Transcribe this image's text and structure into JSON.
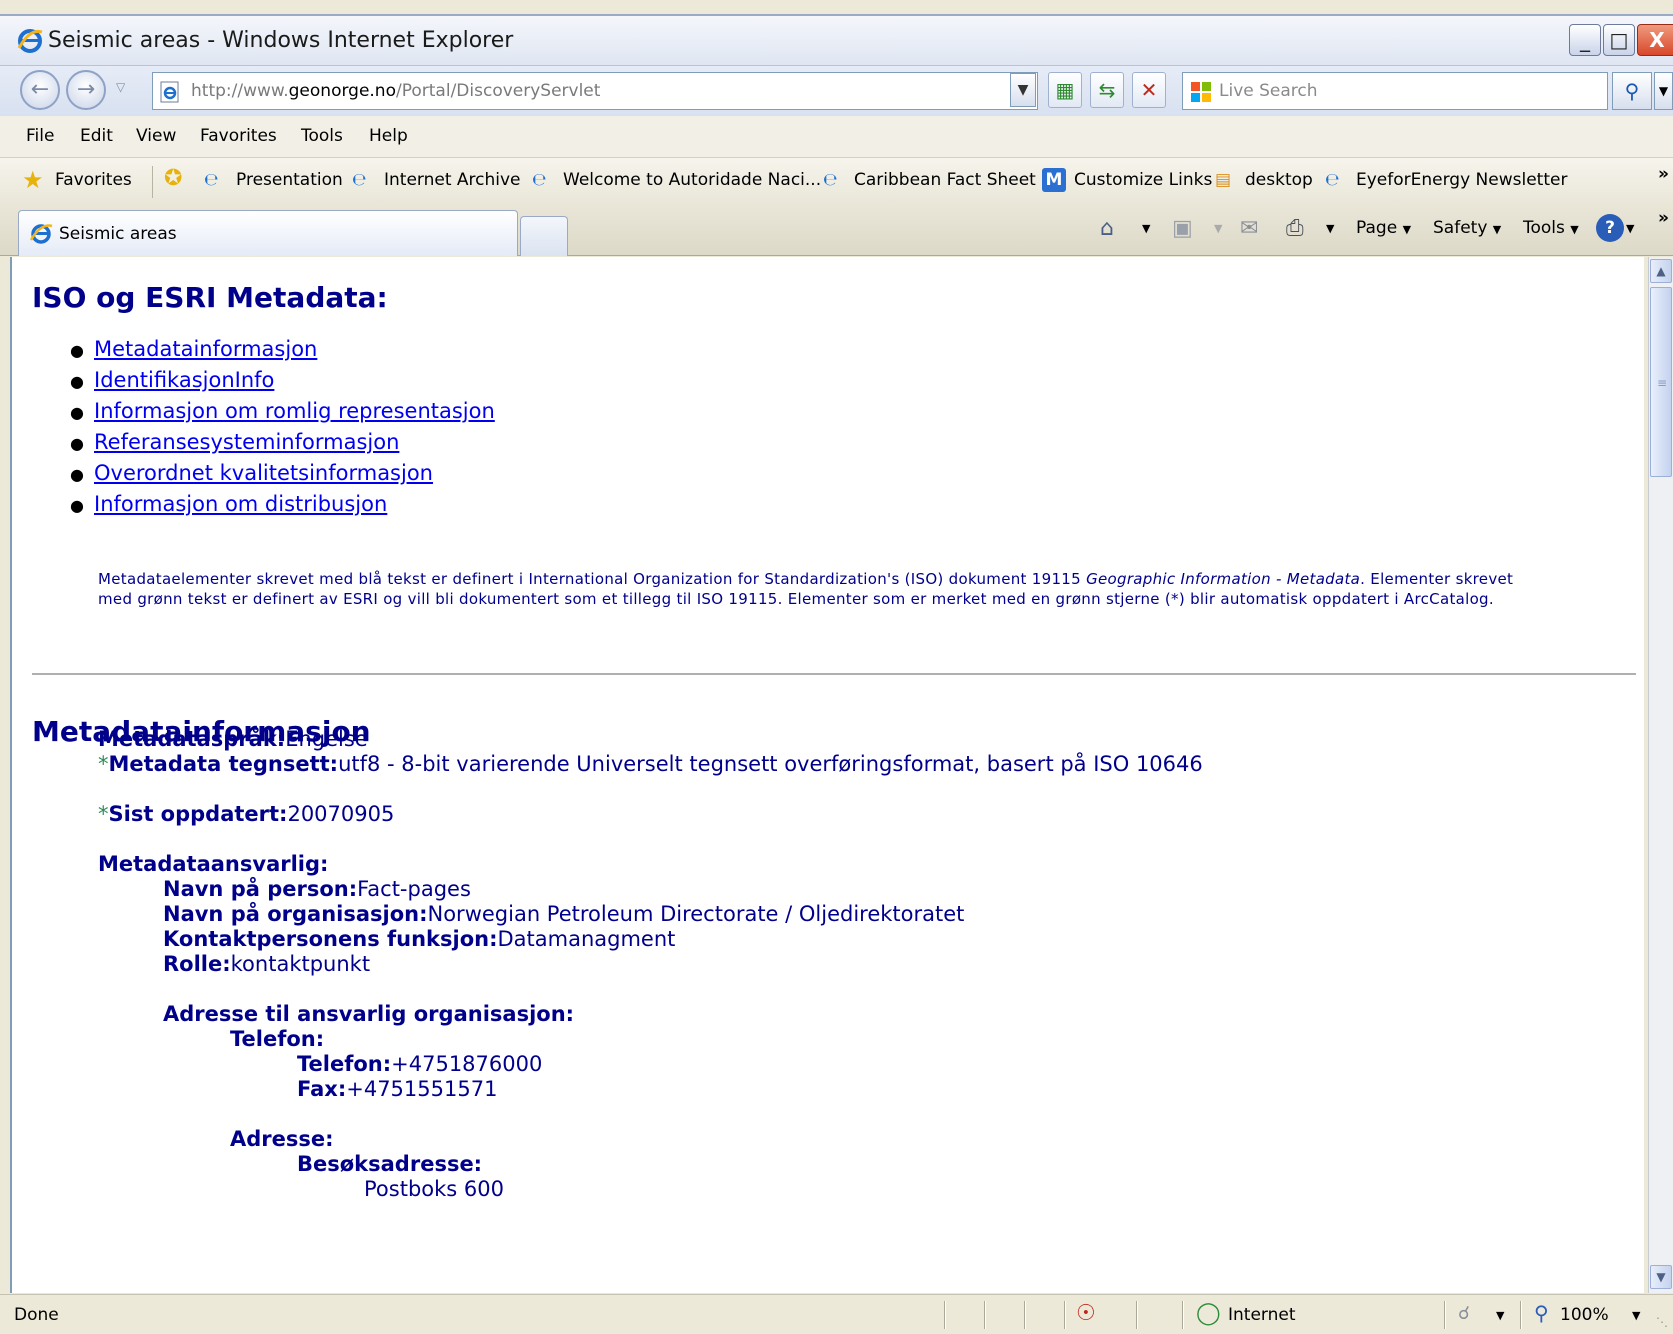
{
  "window": {
    "title": "Seismic areas - Windows Internet Explorer",
    "min_label": "_",
    "max_label": "□",
    "close_label": "X"
  },
  "address": {
    "url_prefix": "http://www.",
    "url_domain": "geonorge.no",
    "url_path": "/Portal/DiscoveryServlet",
    "search_placeholder": "Live Search"
  },
  "menu": {
    "items": [
      "File",
      "Edit",
      "View",
      "Favorites",
      "Tools",
      "Help"
    ]
  },
  "favorites_bar": {
    "favorites_label": "Favorites",
    "links": [
      "Presentation",
      "Internet Archive",
      "Welcome to Autoridade Naci...",
      "Caribbean Fact Sheet",
      "Customize Links",
      "desktop",
      "EyeforEnergy Newsletter"
    ],
    "more": "»"
  },
  "tabs": {
    "active_title": "Seismic areas"
  },
  "command_bar": {
    "page": "Page",
    "safety": "Safety",
    "tools": "Tools",
    "more": "»"
  },
  "content": {
    "iso_heading": "ISO og ESRI Metadata:",
    "toc": [
      "Metadatainformasjon",
      "IdentifikasjonInfo",
      "Informasjon om romlig representasjon",
      "Referansesysteminformasjon",
      "Overordnet kvalitetsinformasjon",
      "Informasjon om distribusjon"
    ],
    "note_part1": "Metadataelementer skrevet med blå tekst er definert i International Organization for Standardization's (ISO) dokument 19115 ",
    "note_italic": "Geographic Information - Metadata",
    "note_part2": ". Elementer skrevet med grønn tekst er definert av ESRI og vill bli dokumentert som et tillegg til ISO 19115. Elementer som er merket med en grønn stjerne (*) blir automatisk oppdatert i ArcCatalog.",
    "meta_heading": "Metadatainformasjon",
    "star": "*",
    "language_label": "Metadataspråk:",
    "language_value": "Engelse",
    "charset_label": "Metadata tegnsett:",
    "charset_value": "utf8 - 8-bit varierende Universelt tegnsett overføringsformat, basert på ISO 10646",
    "updated_label": "Sist oppdatert:",
    "updated_value": "20070905",
    "responsible_label": "Metadataansvarlig:",
    "person_label": "Navn på person:",
    "person_value": "Fact-pages",
    "org_label": "Navn på organisasjon:",
    "org_value": "Norwegian Petroleum Directorate / Oljedirektoratet",
    "function_label": "Kontaktpersonens funksjon:",
    "function_value": "Datamanagment",
    "role_label": "Rolle:",
    "role_value": "kontaktpunkt",
    "address_org_label": "Adresse til ansvarlig organisasjon:",
    "phone_group_label": "Telefon:",
    "phone_label": "Telefon:",
    "phone_value": "+4751876000",
    "fax_label": "Fax:",
    "fax_value": "+4751551571",
    "address_label": "Adresse:",
    "visit_label": "Besøksadresse:",
    "visit_value": "Postboks 600"
  },
  "status": {
    "text": "Done",
    "zone": "Internet",
    "zoom": "100%"
  },
  "colors": {
    "heading": "#00008b",
    "link": "#0000ee",
    "esri_green": "#2e8b57"
  }
}
